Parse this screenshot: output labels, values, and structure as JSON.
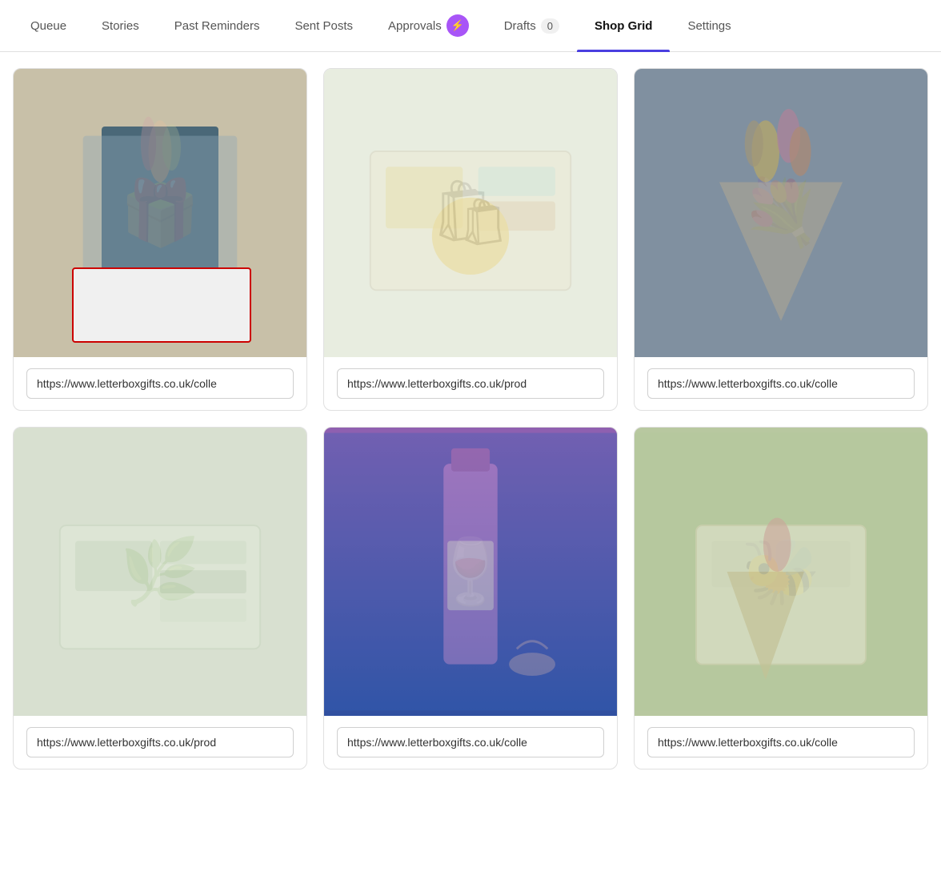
{
  "nav": {
    "items": [
      {
        "id": "queue",
        "label": "Queue",
        "active": false
      },
      {
        "id": "stories",
        "label": "Stories",
        "active": false
      },
      {
        "id": "past-reminders",
        "label": "Past Reminders",
        "active": false
      },
      {
        "id": "sent-posts",
        "label": "Sent Posts",
        "active": false
      },
      {
        "id": "approvals",
        "label": "Approvals",
        "active": false,
        "hasIcon": true
      },
      {
        "id": "drafts",
        "label": "Drafts",
        "active": false,
        "count": "0"
      },
      {
        "id": "shop-grid",
        "label": "Shop Grid",
        "active": true
      },
      {
        "id": "settings",
        "label": "Settings",
        "active": false
      }
    ]
  },
  "grid": {
    "rows": [
      {
        "cards": [
          {
            "id": "card-1",
            "imgClass": "card-img-1",
            "imgLabel": "gift box with platinum jubilee items and flowers",
            "url": "https://www.letterboxgifts.co.uk/colle"
          },
          {
            "id": "card-2",
            "imgClass": "card-img-2",
            "imgLabel": "open gift box with spa and beauty products",
            "url": "https://www.letterboxgifts.co.uk/prod"
          },
          {
            "id": "card-3",
            "imgClass": "card-img-3",
            "imgLabel": "flower cone bouquet being held",
            "url": "https://www.letterboxgifts.co.uk/colle"
          }
        ]
      },
      {
        "cards": [
          {
            "id": "card-4",
            "imgClass": "card-img-4",
            "imgLabel": "relaxation gift set with chocolates and candles",
            "url": "https://www.letterboxgifts.co.uk/prod"
          },
          {
            "id": "card-5",
            "imgClass": "card-img-5",
            "imgLabel": "woman holding wine bottle and glass",
            "url": "https://www.letterboxgifts.co.uk/colle"
          },
          {
            "id": "card-6",
            "imgClass": "card-img-6",
            "imgLabel": "bee revival kit with wildflowers and bee balm",
            "url": "https://www.letterboxgifts.co.uk/colle"
          }
        ]
      }
    ]
  }
}
